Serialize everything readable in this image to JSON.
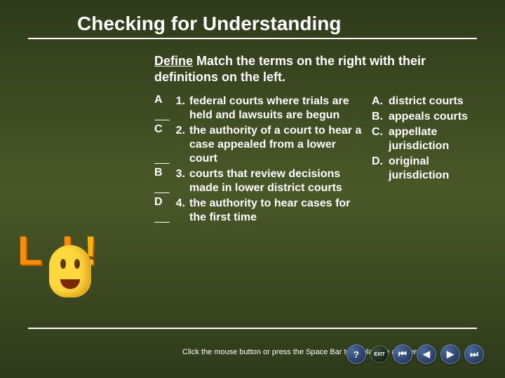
{
  "title": "Checking for Understanding",
  "instructions": {
    "label": "Define",
    "text": "Match the terms on the right with their definitions on the left."
  },
  "definitions": [
    {
      "num": "1.",
      "answer": "A",
      "text": "federal courts where trials are held and lawsuits are begun"
    },
    {
      "num": "2.",
      "answer": "C",
      "text": "the authority of a court to hear a case appealed from a lower court"
    },
    {
      "num": "3.",
      "answer": "B",
      "text": "courts that review decisions made in lower district courts"
    },
    {
      "num": "4.",
      "answer": "D",
      "text": "the authority to hear cases for the first time"
    }
  ],
  "terms": [
    {
      "letter": "A.",
      "text": "district courts"
    },
    {
      "letter": "B.",
      "text": "appeals courts"
    },
    {
      "letter": "C.",
      "text": "appellate jurisdiction"
    },
    {
      "letter": "D.",
      "text": "original jurisdiction"
    }
  ],
  "footer": "Click the mouse button or press the Space Bar to display the answers.",
  "lol": {
    "l1": "L",
    "o": "o",
    "l2": "L",
    "excl": "!"
  },
  "nav": {
    "help": "?",
    "exit": "EXIT",
    "back_end": "⏮",
    "back": "◀",
    "fwd": "▶",
    "fwd_end": "⏭"
  }
}
